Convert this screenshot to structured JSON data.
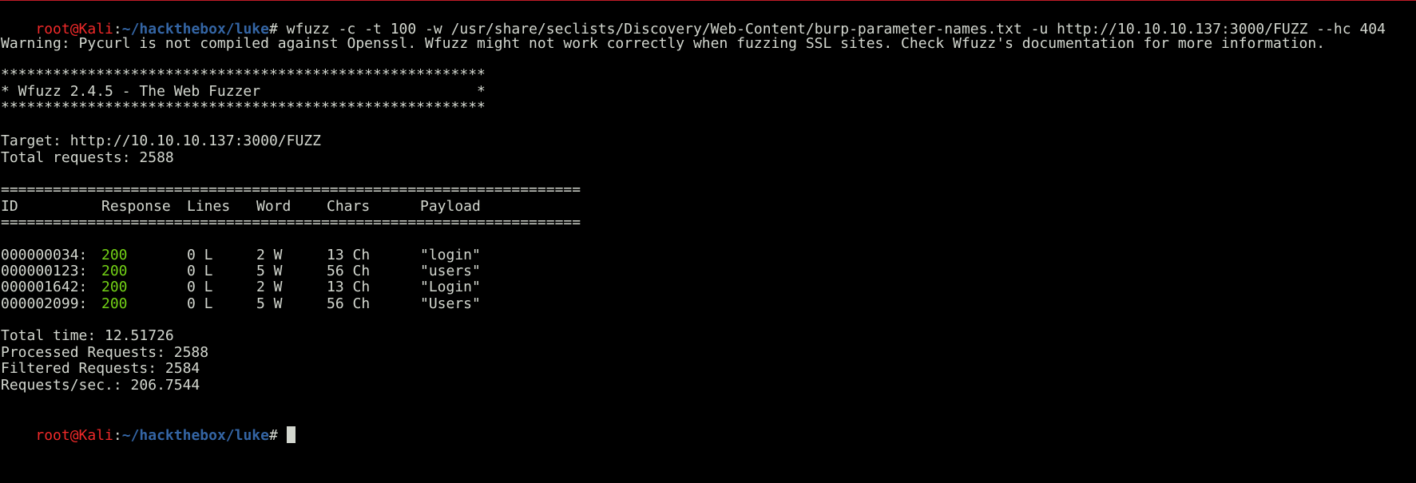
{
  "prompt": {
    "user_host": "root@Kali",
    "separator": ":",
    "path": "~/hackthebox/luke",
    "symbol": "#"
  },
  "command": " wfuzz -c -t 100 -w /usr/share/seclists/Discovery/Web-Content/burp-parameter-names.txt -u http://10.10.10.137:3000/FUZZ --hc 404",
  "warning": "Warning: Pycurl is not compiled against Openssl. Wfuzz might not work correctly when fuzzing SSL sites. Check Wfuzz's documentation for more information.",
  "banner": {
    "border": "********************************************************",
    "title": "* Wfuzz 2.4.5 - The Web Fuzzer                         *"
  },
  "target": "Target: http://10.10.10.137:3000/FUZZ",
  "total_requests": "Total requests: 2588",
  "separator_line": "===================================================================",
  "headers": [
    "ID",
    "Response",
    "Lines",
    "Word",
    "Chars",
    "Payload"
  ],
  "rows": [
    {
      "id": "000000034:",
      "response": "200",
      "lines": "0 L",
      "word": "2 W",
      "chars": "13 Ch",
      "payload": "\"login\""
    },
    {
      "id": "000000123:",
      "response": "200",
      "lines": "0 L",
      "word": "5 W",
      "chars": "56 Ch",
      "payload": "\"users\""
    },
    {
      "id": "000001642:",
      "response": "200",
      "lines": "0 L",
      "word": "2 W",
      "chars": "13 Ch",
      "payload": "\"Login\""
    },
    {
      "id": "000002099:",
      "response": "200",
      "lines": "0 L",
      "word": "5 W",
      "chars": "56 Ch",
      "payload": "\"Users\""
    }
  ],
  "stats": {
    "total_time": "Total time: 12.51726",
    "processed": "Processed Requests: 2588",
    "filtered": "Filtered Requests: 2584",
    "rate": "Requests/sec.: 206.7544"
  },
  "colors": {
    "background": "#000000",
    "text": "#d3d7cf",
    "prompt_user": "#ef2929",
    "prompt_path": "#3465a4",
    "status_ok": "#73d216"
  }
}
